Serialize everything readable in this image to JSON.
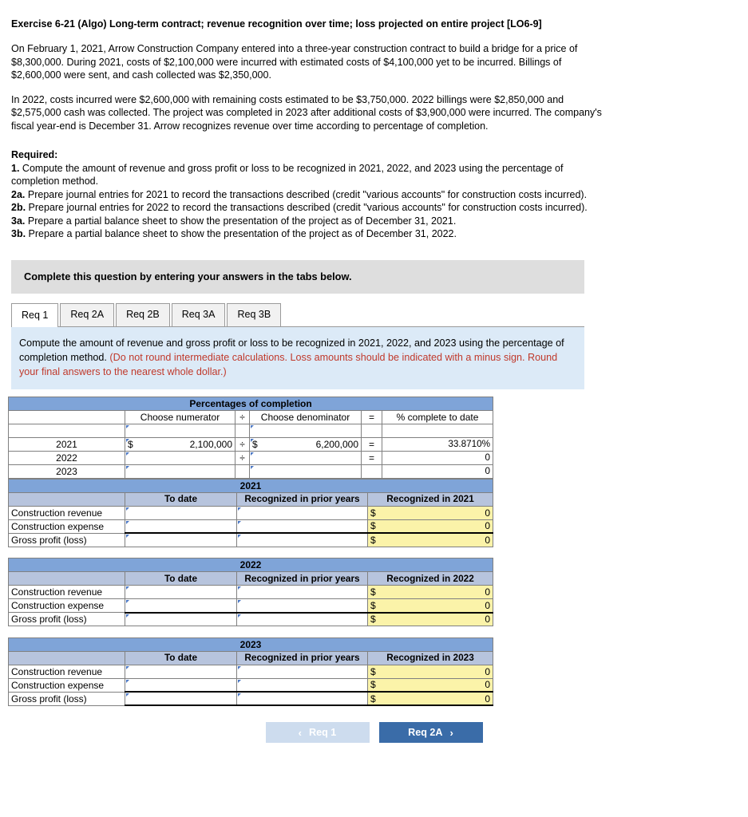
{
  "exercise": {
    "title": "Exercise 6-21 (Algo) Long-term contract; revenue recognition over time; loss projected on entire project [LO6-9]",
    "paragraph1": "On February 1, 2021, Arrow Construction Company entered into a three-year construction contract to build a bridge for a price of $8,300,000. During 2021, costs of $2,100,000 were incurred with estimated costs of $4,100,000 yet to be incurred. Billings of $2,600,000 were sent, and cash collected was $2,350,000.",
    "paragraph2": "In 2022, costs incurred were $2,600,000 with remaining costs estimated to be $3,750,000. 2022 billings were $2,850,000 and $2,575,000 cash was collected. The project was completed in 2023 after additional costs of $3,900,000 were incurred. The company's fiscal year-end is December 31. Arrow recognizes revenue over time according to percentage of completion.",
    "required_heading": "Required:",
    "requirements": [
      {
        "num": "1.",
        "text": " Compute the amount of revenue and gross profit or loss to be recognized in 2021, 2022, and 2023 using the percentage of completion method."
      },
      {
        "num": "2a.",
        "text": " Prepare journal entries for 2021 to record the transactions described (credit \"various accounts\" for construction costs incurred)."
      },
      {
        "num": "2b.",
        "text": " Prepare journal entries for 2022 to record the transactions described (credit \"various accounts\" for construction costs incurred)."
      },
      {
        "num": "3a.",
        "text": " Prepare a partial balance sheet to show the presentation of the project as of December 31, 2021."
      },
      {
        "num": "3b.",
        "text": " Prepare a partial balance sheet to show the presentation of the project as of December 31, 2022."
      }
    ]
  },
  "banner": {
    "text": "Complete this question by entering your answers in the tabs below."
  },
  "tabs": [
    {
      "label": "Req 1",
      "active": true
    },
    {
      "label": "Req 2A",
      "active": false
    },
    {
      "label": "Req 2B",
      "active": false
    },
    {
      "label": "Req 3A",
      "active": false
    },
    {
      "label": "Req 3B",
      "active": false
    }
  ],
  "instruction": {
    "black": "Compute the amount of revenue and gross profit or loss to be recognized in 2021, 2022, and 2023 using the percentage of completion method.",
    "red": "(Do not round intermediate calculations. Loss amounts should be indicated with a minus sign. Round your final answers to the nearest whole dollar.)"
  },
  "percentages_table": {
    "title": "Percentages of completion",
    "headers": {
      "blank": "",
      "numerator": "Choose numerator",
      "divide": "÷",
      "denominator": "Choose denominator",
      "equals": "=",
      "result": "% complete to date"
    },
    "rows": [
      {
        "year": "",
        "num_dollar": "",
        "num_value": "",
        "op1": "",
        "den_dollar": "",
        "den_value": "",
        "op2": "",
        "pct": ""
      },
      {
        "year": "2021",
        "num_dollar": "$",
        "num_value": "2,100,000",
        "op1": "÷",
        "den_dollar": "$",
        "den_value": "6,200,000",
        "op2": "=",
        "pct": "33.8710%"
      },
      {
        "year": "2022",
        "num_dollar": "",
        "num_value": "",
        "op1": "÷",
        "den_dollar": "",
        "den_value": "",
        "op2": "=",
        "pct": "0"
      },
      {
        "year": "2023",
        "num_dollar": "",
        "num_value": "",
        "op1": "",
        "den_dollar": "",
        "den_value": "",
        "op2": "",
        "pct": "0"
      }
    ]
  },
  "year_sections": [
    {
      "year": "2021",
      "columns": {
        "blank": "",
        "to_date": "To date",
        "prior": "Recognized in prior years",
        "recognized": "Recognized in 2021"
      },
      "rows": [
        {
          "label": "Construction revenue",
          "to_date": "",
          "prior": "",
          "rec_dollar": "$",
          "rec_value": "0"
        },
        {
          "label": "Construction expense",
          "to_date": "",
          "prior": "",
          "rec_dollar": "$",
          "rec_value": "0"
        },
        {
          "label": "Gross profit (loss)",
          "to_date": "",
          "prior": "",
          "rec_dollar": "$",
          "rec_value": "0"
        }
      ]
    },
    {
      "year": "2022",
      "columns": {
        "blank": "",
        "to_date": "To date",
        "prior": "Recognized in prior years",
        "recognized": "Recognized in 2022"
      },
      "rows": [
        {
          "label": "Construction revenue",
          "to_date": "",
          "prior": "",
          "rec_dollar": "$",
          "rec_value": "0"
        },
        {
          "label": "Construction expense",
          "to_date": "",
          "prior": "",
          "rec_dollar": "$",
          "rec_value": "0"
        },
        {
          "label": "Gross profit (loss)",
          "to_date": "",
          "prior": "",
          "rec_dollar": "$",
          "rec_value": "0"
        }
      ]
    },
    {
      "year": "2023",
      "columns": {
        "blank": "",
        "to_date": "To date",
        "prior": "Recognized in prior years",
        "recognized": "Recognized in 2023"
      },
      "rows": [
        {
          "label": "Construction revenue",
          "to_date": "",
          "prior": "",
          "rec_dollar": "$",
          "rec_value": "0"
        },
        {
          "label": "Construction expense",
          "to_date": "",
          "prior": "",
          "rec_dollar": "$",
          "rec_value": "0"
        },
        {
          "label": "Gross profit (loss)",
          "to_date": "",
          "prior": "",
          "rec_dollar": "$",
          "rec_value": "0"
        }
      ]
    }
  ],
  "nav": {
    "prev_label": "Req 1",
    "prev_chevron": "‹",
    "next_label": "Req 2A",
    "next_chevron": "›"
  },
  "colors": {
    "blue_header": "#7fa4d8",
    "sub_header": "#b7c4dd",
    "instruction_bg": "#dceaf7",
    "red_text": "#c0392b",
    "yellow_cell": "#fbf3a9",
    "button_active": "#3a6ca8",
    "button_disabled": "#cddcee"
  }
}
